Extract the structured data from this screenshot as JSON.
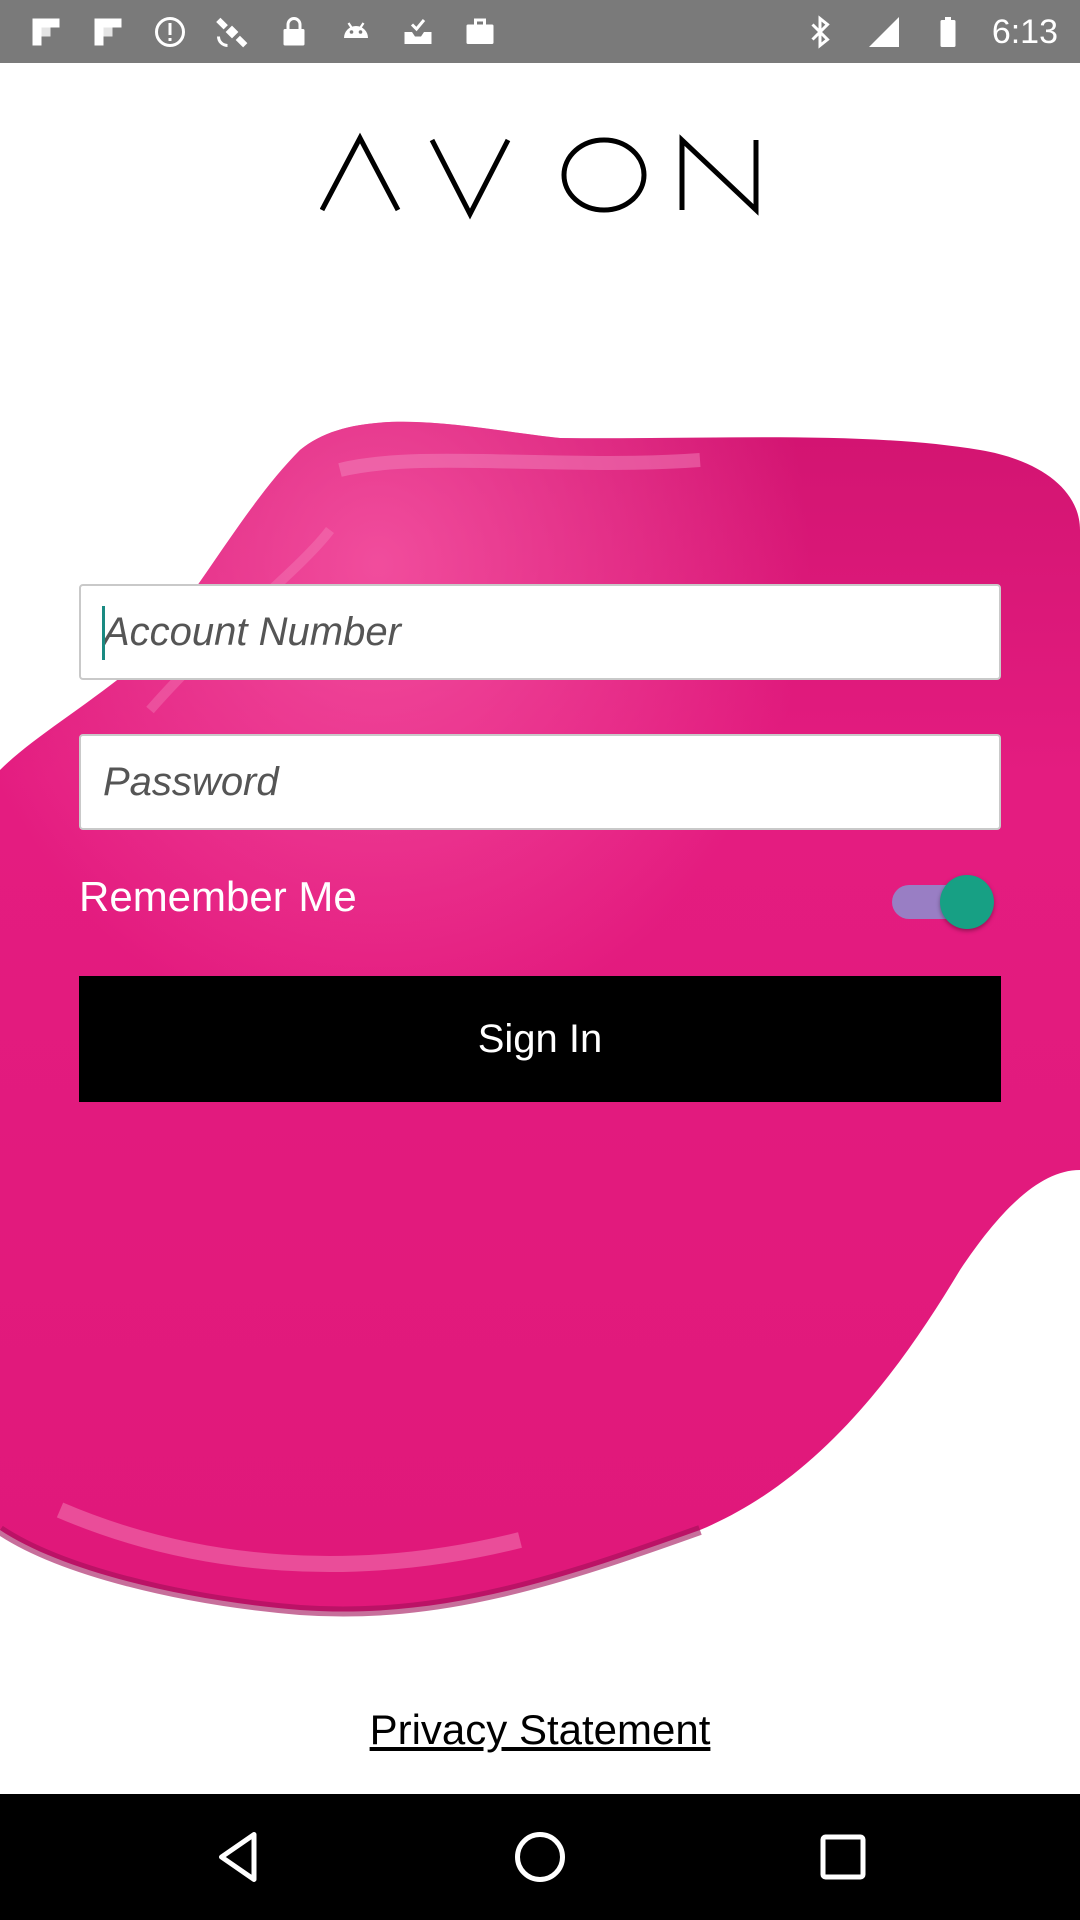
{
  "status_bar": {
    "time": "6:13",
    "left_icons": [
      "flipboard-icon",
      "flipboard-icon",
      "alert-icon",
      "satellite-icon",
      "lock-icon",
      "android-icon",
      "inbox-check-icon",
      "briefcase-icon"
    ],
    "right_icons": [
      "bluetooth-icon",
      "signal-icon",
      "battery-icon"
    ]
  },
  "brand": {
    "logo_text": "AVON"
  },
  "login_form": {
    "account_placeholder": "Account Number",
    "password_placeholder": "Password",
    "remember_label": "Remember Me",
    "remember_enabled": true,
    "sign_in_label": "Sign In"
  },
  "footer": {
    "privacy_label": "Privacy Statement"
  },
  "nav_bar": {
    "buttons": [
      "back-icon",
      "home-icon",
      "recents-icon"
    ]
  },
  "colors": {
    "status_bar": "#7a7a7a",
    "splash_pink": "#e0187a",
    "toggle_thumb": "#17a084",
    "toggle_track": "#8c8fd0",
    "button_bg": "#000000"
  }
}
